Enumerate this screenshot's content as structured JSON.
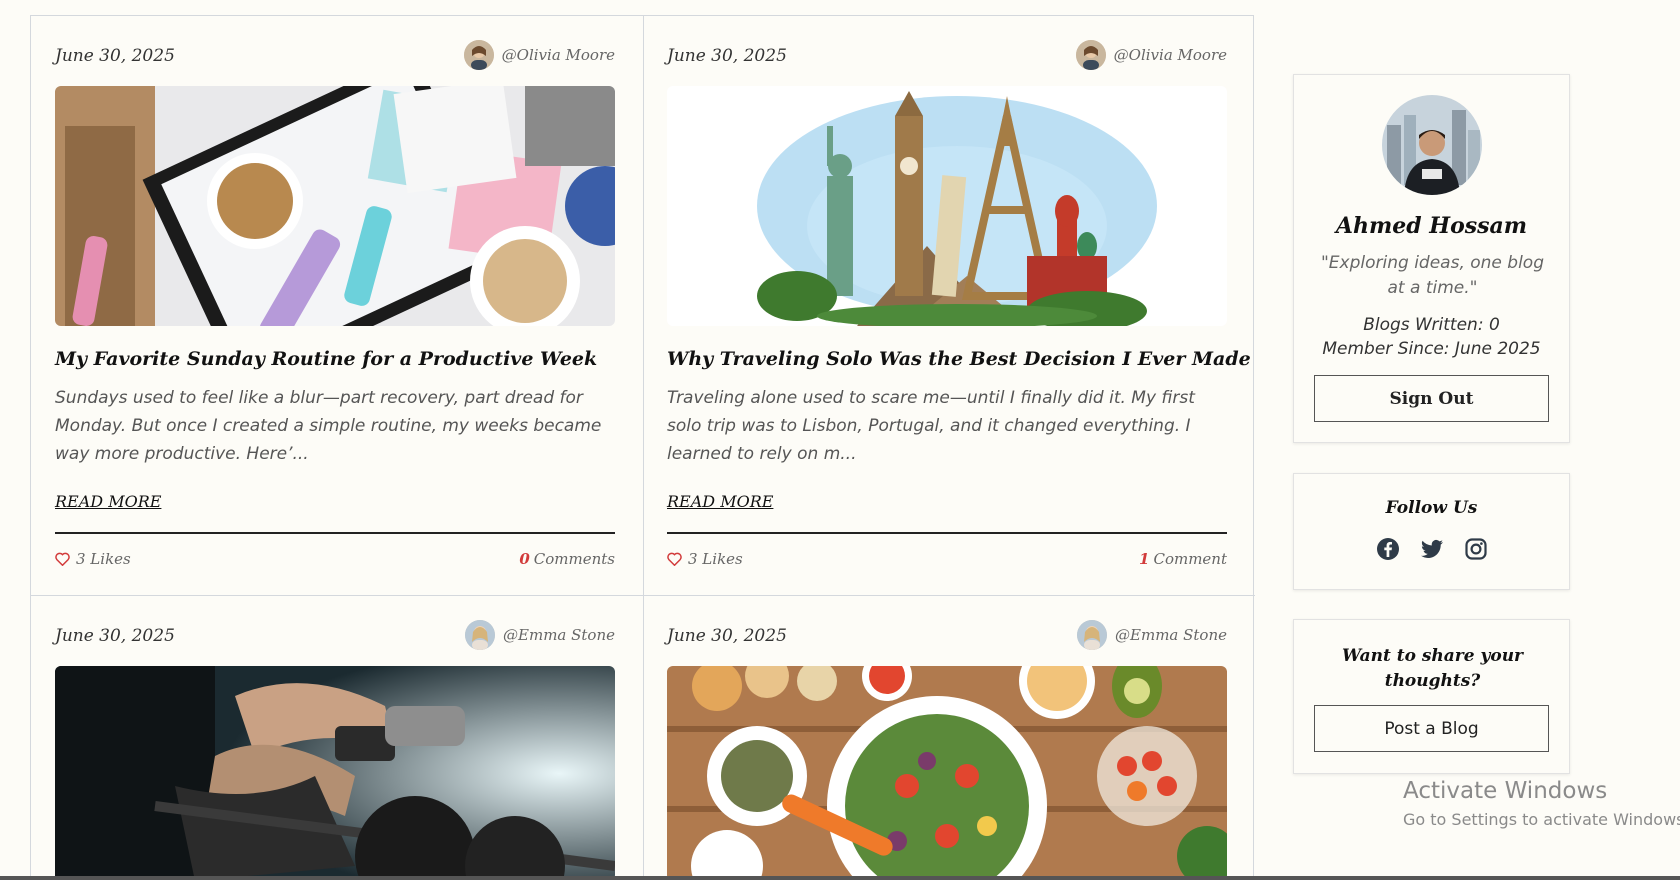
{
  "posts": [
    {
      "date": "June 30, 2025",
      "author": "@Olivia Moore",
      "title": "My Favorite Sunday Routine for a Productive Week",
      "excerpt": "Sundays used to feel like a blur—part recovery, part dread for Monday. But once I created a simple routine, my weeks became way more productive. Here’...",
      "read_more": "READ MORE",
      "likes": "3 Likes",
      "comment_count": "0",
      "comment_label": "Comments"
    },
    {
      "date": "June 30, 2025",
      "author": "@Olivia Moore",
      "title": "Why Traveling Solo Was the Best Decision I Ever Made",
      "excerpt": "Traveling alone used to scare me—until I finally did it. My first solo trip was to Lisbon, Portugal, and it changed everything. I learned to rely on m...",
      "read_more": "READ MORE",
      "likes": "3 Likes",
      "comment_count": "1",
      "comment_label": "Comment"
    },
    {
      "date": "June 30, 2025",
      "author": "@Emma Stone"
    },
    {
      "date": "June 30, 2025",
      "author": "@Emma Stone"
    }
  ],
  "profile": {
    "name": "Ahmed Hossam",
    "quote": "\"Exploring ideas, one blog at a time.\"",
    "blogs_written": "Blogs Written: 0",
    "member_since": "Member Since: June 2025",
    "sign_out": "Sign Out"
  },
  "follow": {
    "title": "Follow Us",
    "icons": [
      "facebook-icon",
      "twitter-icon",
      "instagram-icon"
    ]
  },
  "share": {
    "title": "Want to share your thoughts?",
    "button": "Post a Blog"
  },
  "watermark": {
    "line1": "Activate Windows",
    "line2": "Go to Settings to activate Windows."
  },
  "colors": {
    "background": "#fdfcf7",
    "accent_red": "#d23b3b",
    "border": "#d4d8dd"
  }
}
